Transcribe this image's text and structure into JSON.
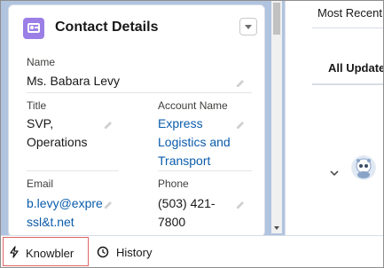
{
  "contact_card": {
    "title": "Contact Details",
    "header_icon": "contact-card-icon",
    "fields": {
      "name_label": "Name",
      "name_value": "Ms. Babara Levy",
      "title_label": "Title",
      "title_value_line1": "SVP,",
      "title_value_line2": "Operations",
      "account_label": "Account Name",
      "account_value_line1": "Express",
      "account_value_line2": "Logistics and",
      "account_value_line3": "Transport",
      "email_label": "Email",
      "email_value_line1": "b.levy@expre",
      "email_value_line2": "ssl&t.net",
      "phone_label": "Phone",
      "phone_value_line1": "(503) 421-",
      "phone_value_line2": "7800"
    }
  },
  "feed": {
    "sort_label": "Most Recent A",
    "tab_label": "All Update"
  },
  "bottom_tabs": [
    {
      "label": "Knowbler",
      "icon": "lightning-icon"
    },
    {
      "label": "History",
      "icon": "clock-icon"
    }
  ],
  "colors": {
    "accent_link": "#0b5cab",
    "header_icon_bg": "#9b7fe6",
    "background_blue": "#b0c4df",
    "highlight_border": "#e06666"
  }
}
